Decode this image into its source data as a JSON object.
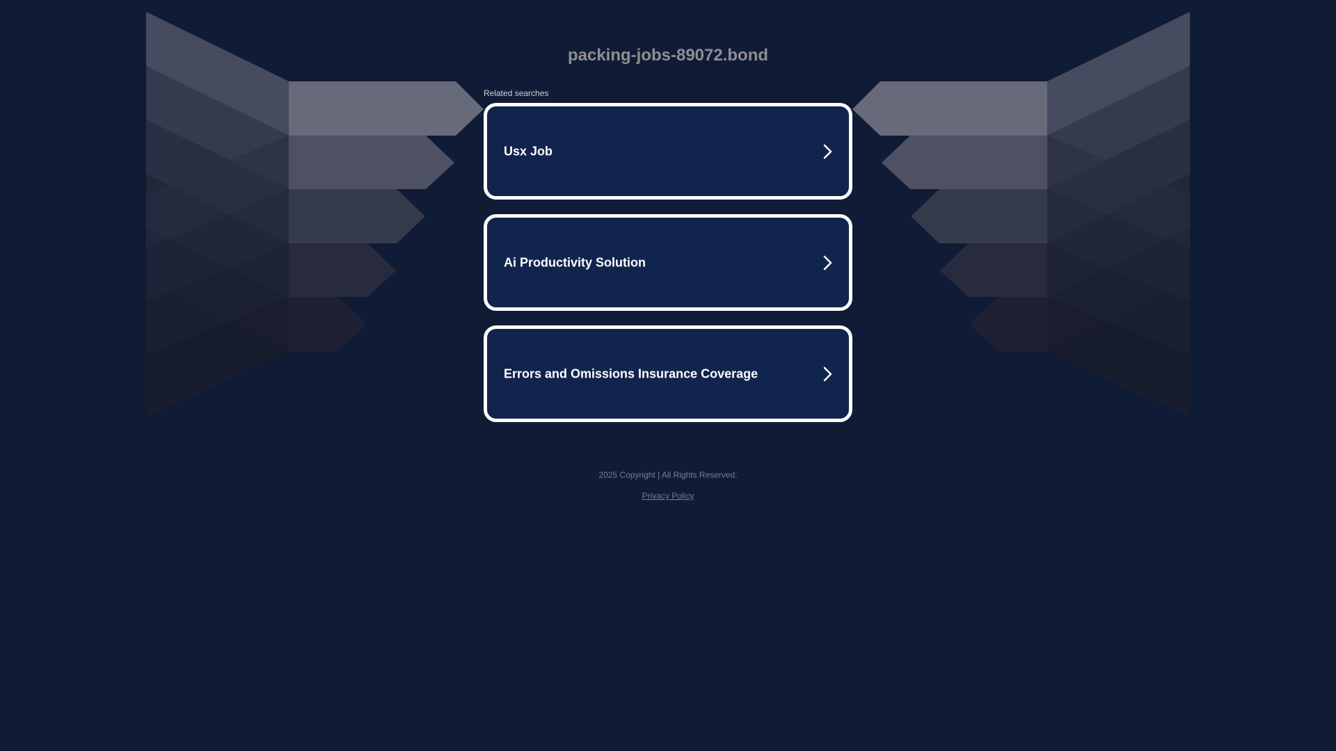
{
  "page": {
    "domain": "packing-jobs-89072.bond",
    "related_label": "Related searches"
  },
  "results": [
    {
      "label": "Usx Job"
    },
    {
      "label": "Ai Productivity Solution"
    },
    {
      "label": "Errors and Omissions Insurance Coverage"
    }
  ],
  "footer": {
    "copyright": "2025 Copyright | All Rights Reserved.",
    "privacy_label": "Privacy Policy"
  },
  "colors": {
    "background": "#101c36",
    "card_background": "#11244d",
    "card_border": "#ffffff",
    "title": "#8e8e93"
  },
  "icons": {
    "result_arrow": "chevron-right-icon"
  }
}
